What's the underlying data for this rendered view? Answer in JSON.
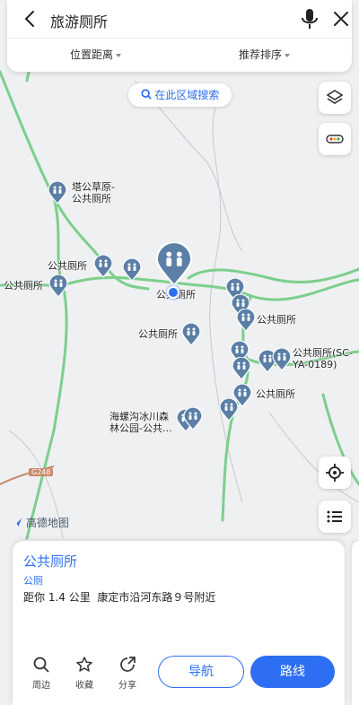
{
  "search": {
    "title": "旅游厕所"
  },
  "filters": {
    "distance": "位置距离",
    "sort": "推荐排序"
  },
  "area_search": "在此区域搜索",
  "map": {
    "logo": "高德地图",
    "road_code": "G248",
    "labels": {
      "tagong_line1": "塔公草原-",
      "tagong_line2": "公共厕所",
      "toilet_a": "公共厕所",
      "toilet_b": "公共厕所",
      "toilet_center": "公共厕所",
      "toilet_c": "公共厕所",
      "toilet_d": "公共厕所",
      "toilet_sc_line1": "公共厕所(SC-",
      "toilet_sc_line2": "YA-0189)",
      "toilet_e": "公共厕所",
      "hailuogou_line1": "海螺沟冰川森",
      "hailuogou_line2": "林公园-公共..."
    }
  },
  "poi": {
    "name": "公共厕所",
    "type": "公厕",
    "distance": "距你 1.4 公里",
    "address": "康定市沿河东路９号附近"
  },
  "actions": {
    "nearby": "周边",
    "favorite": "收藏",
    "share": "分享",
    "navigate": "导航",
    "route": "路线"
  },
  "colors": {
    "accent": "#2d6ef2",
    "pin": "#5b7fa6",
    "road": "#7ccf8c"
  }
}
